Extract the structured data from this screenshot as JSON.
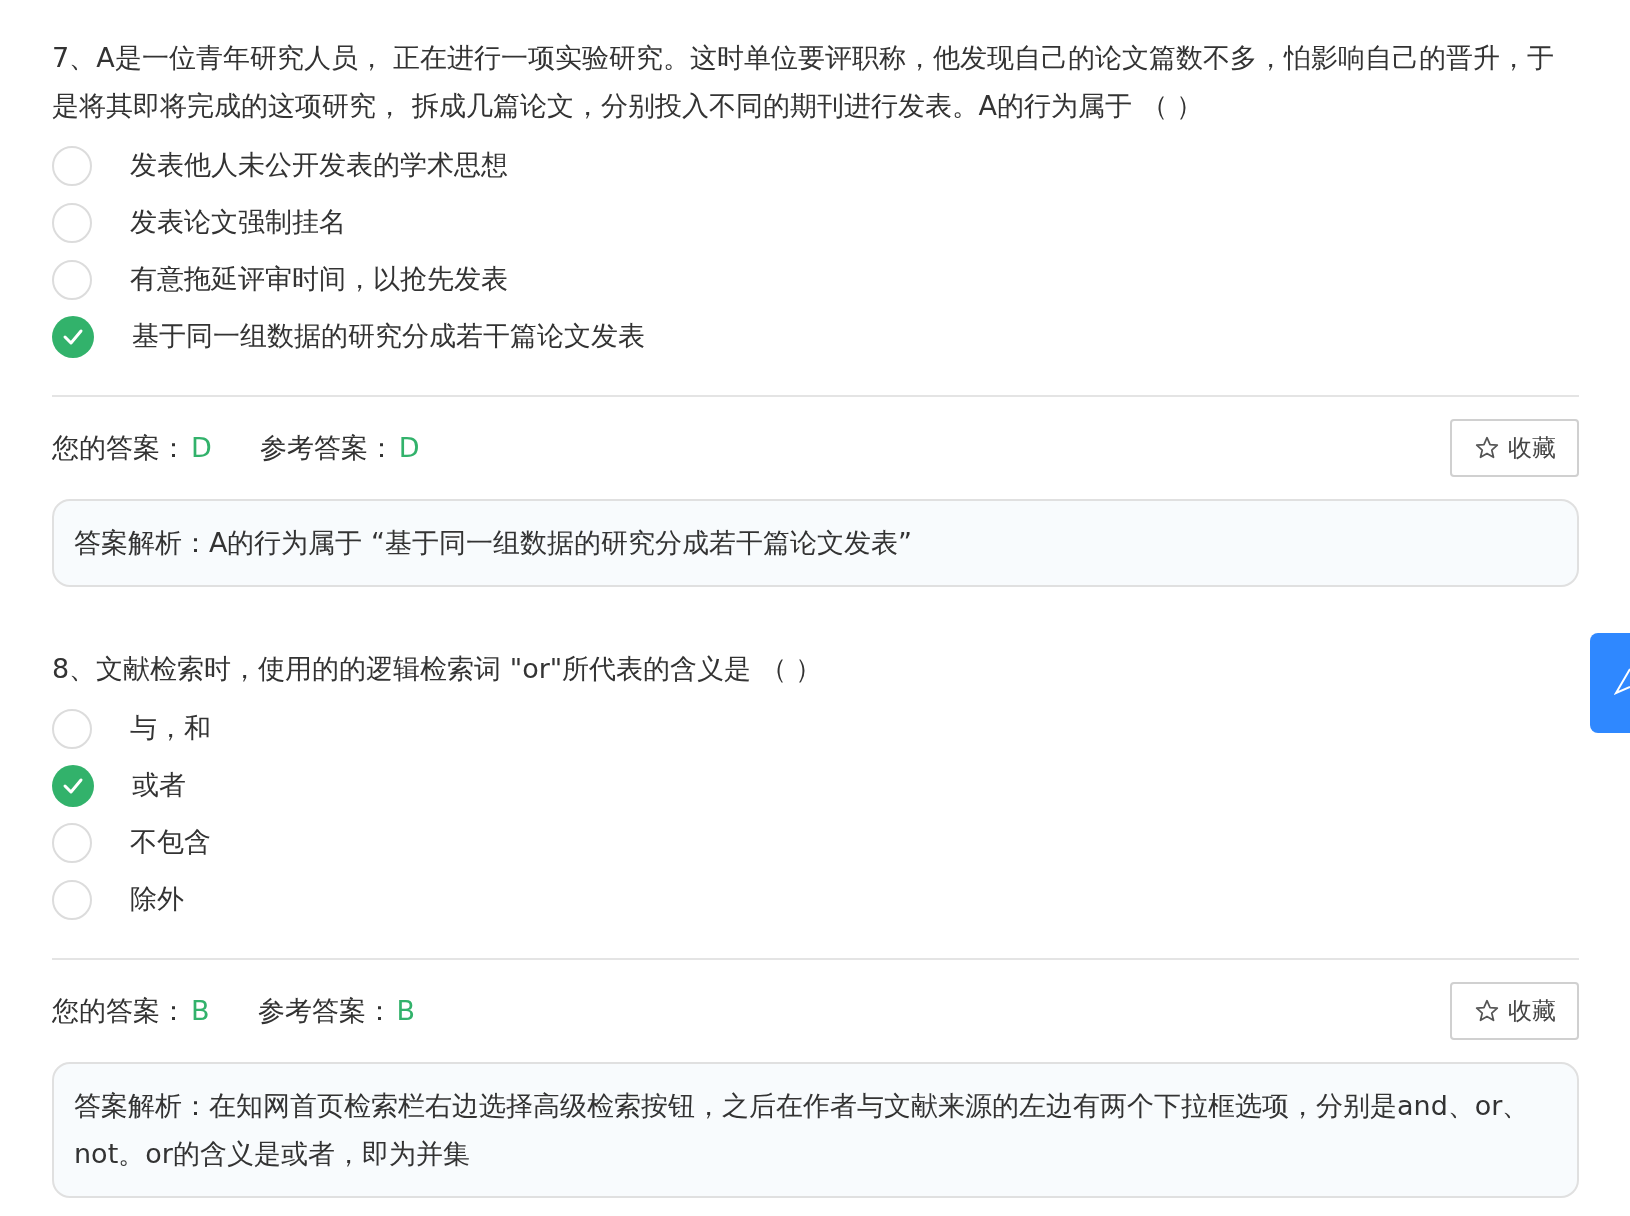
{
  "questions": [
    {
      "text": "7、A是一位青年研究人员， 正在进行一项实验研究。这时单位要评职称，他发现自己的论文篇数不多，怕影响自己的晋升，于是将其即将完成的这项研究， 拆成几篇论文，分别投入不同的期刊进行发表。A的行为属于 （ ）",
      "options": [
        {
          "label": "发表他人未公开发表的学术思想",
          "selected": false
        },
        {
          "label": "发表论文强制挂名",
          "selected": false
        },
        {
          "label": "有意拖延评审时间，以抢先发表",
          "selected": false
        },
        {
          "label": "基于同一组数据的研究分成若干篇论文发表",
          "selected": true
        }
      ],
      "your_answer_label": "您的答案：",
      "your_answer": "D",
      "reference_label": "参考答案：",
      "reference_answer": "D",
      "favorite_button": "收藏",
      "explanation": "答案解析：A的行为属于 “基于同一组数据的研究分成若干篇论文发表”"
    },
    {
      "text": "8、文献检索时，使用的的逻辑检索词 \"or\"所代表的含义是 （ ）",
      "options": [
        {
          "label": "与，和",
          "selected": false
        },
        {
          "label": "或者",
          "selected": true
        },
        {
          "label": "不包含",
          "selected": false
        },
        {
          "label": "除外",
          "selected": false
        }
      ],
      "your_answer_label": "您的答案：",
      "your_answer": "B",
      "reference_label": "参考答案：",
      "reference_answer": "B",
      "favorite_button": "收藏",
      "explanation": "答案解析：在知网首页检索栏右边选择高级检索按钮，之后在作者与文献来源的左边有两个下拉框选项，分别是and、or、not。or的含义是或者，即为并集"
    }
  ]
}
